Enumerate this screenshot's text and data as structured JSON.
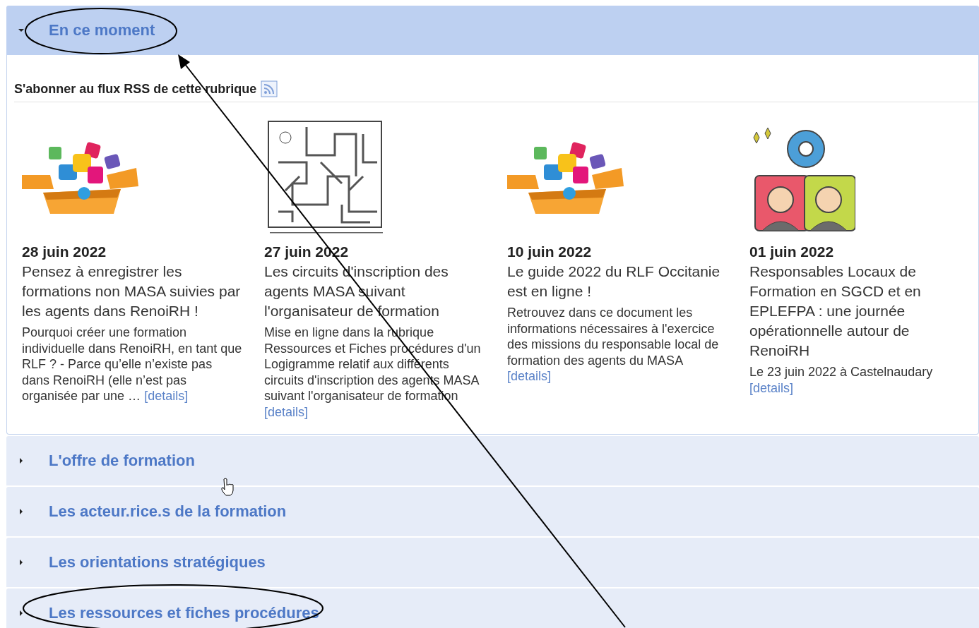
{
  "sections": [
    {
      "title": "En ce moment",
      "expanded": true,
      "rss_label": "S'abonner au flux RSS de cette rubrique",
      "articles": [
        {
          "date": "28 juin 2022",
          "title": "Pensez à enregistrer les formations non MASA suivies par les agents dans RenoiRH !",
          "summary": "Pourquoi créer une formation individuelle dans RenoiRH, en tant que RLF ? -  Parce  qu’elle  n’existe pas  dans  RenoiRH  (elle  n’est  pas organisée  par  une …",
          "link": "[details]"
        },
        {
          "date": "27 juin 2022",
          "title": "Les circuits d'inscription des agents MASA suivant l'organisateur de formation",
          "summary": "Mise en ligne dans la rubrique Ressources et Fiches procédures d'un Logigramme relatif aux différents circuits d'inscription des agents MASA suivant l'organisateur de formation",
          "link": "[details]"
        },
        {
          "date": "10 juin 2022",
          "title": "Le guide 2022 du RLF Occitanie est en ligne !",
          "summary": "Retrouvez dans ce document les informations nécessaires à l'exercice des missions du responsable local de formation des agents du MASA",
          "link": "[details]"
        },
        {
          "date": "01 juin 2022",
          "title": "Responsables Locaux de Formation en SGCD et en EPLEFPA : une journée opérationnelle autour de RenoiRH",
          "summary": "Le 23 juin 2022 à Castelnaudary",
          "link": "[details]"
        }
      ]
    },
    {
      "title": "L'offre de formation",
      "expanded": false
    },
    {
      "title": "Les acteur.rice.s de la formation",
      "expanded": false
    },
    {
      "title": "Les orientations stratégiques",
      "expanded": false
    },
    {
      "title": "Les ressources et fiches procédures",
      "expanded": false
    }
  ]
}
